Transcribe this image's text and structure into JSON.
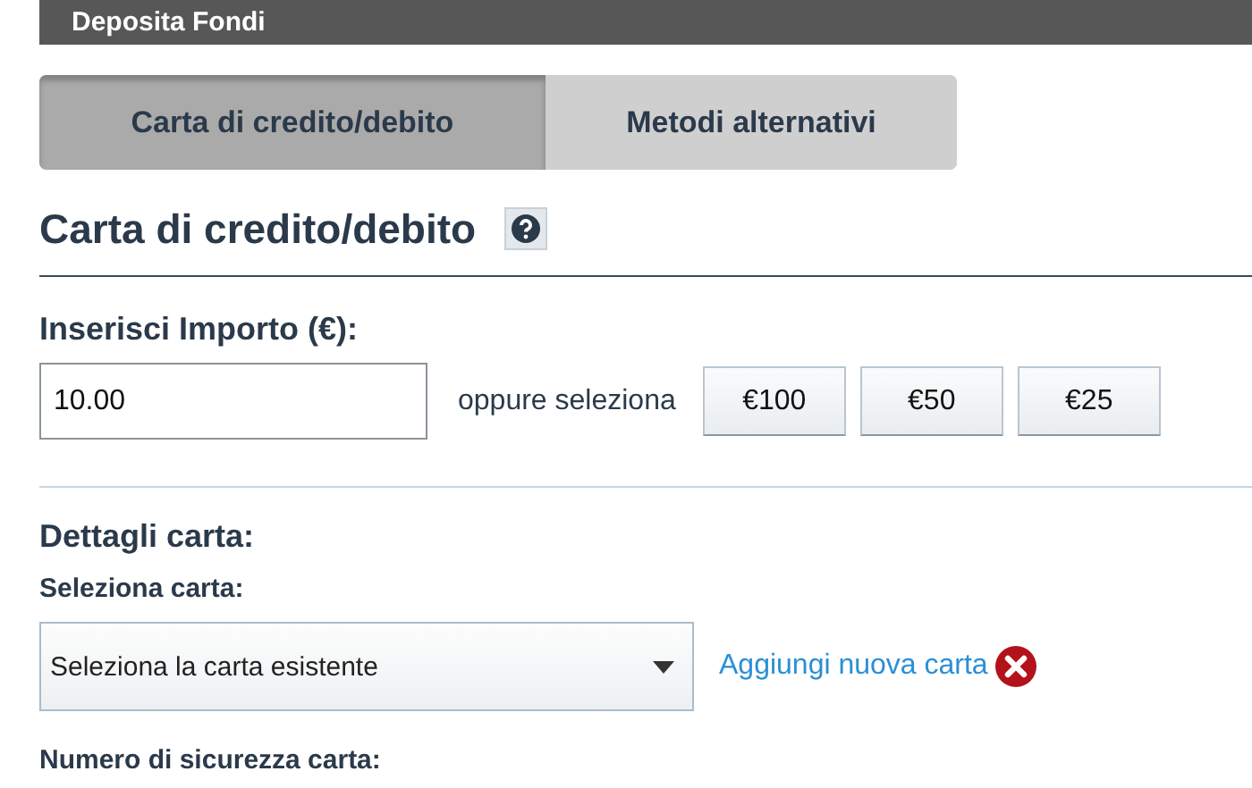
{
  "header": {
    "title": "Deposita Fondi"
  },
  "tabs": [
    {
      "label": "Carta di credito/debito",
      "selected": true
    },
    {
      "label": "Metodi alternativi",
      "selected": false
    }
  ],
  "section_title": "Carta di credito/debito",
  "amount": {
    "label": "Inserisci Importo (€):",
    "value": "10.00",
    "or_text": "oppure seleziona",
    "presets": [
      "€100",
      "€50",
      "€25"
    ]
  },
  "card_details": {
    "title": "Dettagli carta:",
    "select_label": "Seleziona carta:",
    "select_value": "Seleziona la carta esistente",
    "add_link": "Aggiungi nuova carta",
    "security_label": "Numero di sicurezza carta:"
  }
}
